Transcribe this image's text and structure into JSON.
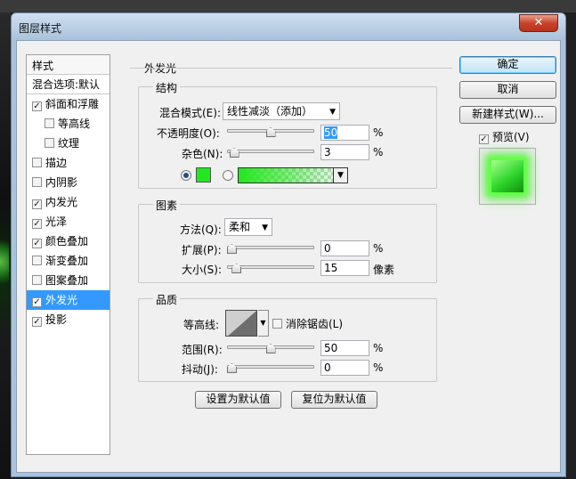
{
  "window": {
    "title": "图层样式",
    "close_label": "✕"
  },
  "style_list": {
    "header": "样式",
    "blend_options": "混合选项:默认",
    "items": [
      {
        "label": "斜面和浮雕",
        "checked": true,
        "sub": false,
        "selected": false
      },
      {
        "label": "等高线",
        "checked": false,
        "sub": true,
        "selected": false
      },
      {
        "label": "纹理",
        "checked": false,
        "sub": true,
        "selected": false
      },
      {
        "label": "描边",
        "checked": false,
        "sub": false,
        "selected": false
      },
      {
        "label": "内阴影",
        "checked": false,
        "sub": false,
        "selected": false
      },
      {
        "label": "内发光",
        "checked": true,
        "sub": false,
        "selected": false
      },
      {
        "label": "光泽",
        "checked": true,
        "sub": false,
        "selected": false
      },
      {
        "label": "颜色叠加",
        "checked": true,
        "sub": false,
        "selected": false
      },
      {
        "label": "渐变叠加",
        "checked": false,
        "sub": false,
        "selected": false
      },
      {
        "label": "图案叠加",
        "checked": false,
        "sub": false,
        "selected": false
      },
      {
        "label": "外发光",
        "checked": true,
        "sub": false,
        "selected": true
      },
      {
        "label": "投影",
        "checked": true,
        "sub": false,
        "selected": false
      }
    ]
  },
  "panel": {
    "title": "外发光",
    "structure": {
      "title": "结构",
      "blend_mode_label": "混合模式(E):",
      "blend_mode_value": "线性减淡（添加）",
      "opacity_label": "不透明度(O):",
      "opacity_value": "50",
      "opacity_fraction": 0.5,
      "noise_label": "杂色(N):",
      "noise_value": "3",
      "noise_fraction": 0.03,
      "percent": "%",
      "glow_color": "#22e81e"
    },
    "elements": {
      "title": "图素",
      "method_label": "方法(Q):",
      "method_value": "柔和",
      "spread_label": "扩展(P):",
      "spread_value": "0",
      "spread_fraction": 0,
      "size_label": "大小(S):",
      "size_value": "15",
      "size_fraction": 0.06,
      "percent": "%",
      "pixels": "像素"
    },
    "quality": {
      "title": "品质",
      "contour_label": "等高线:",
      "anti_alias_label": "消除锯齿(L)",
      "anti_alias_checked": false,
      "range_label": "范围(R):",
      "range_value": "50",
      "range_fraction": 0.5,
      "jitter_label": "抖动(J):",
      "jitter_value": "0",
      "jitter_fraction": 0,
      "percent": "%"
    },
    "set_default": "设置为默认值",
    "reset_default": "复位为默认值"
  },
  "actions": {
    "ok": "确定",
    "cancel": "取消",
    "new_style": "新建样式(W)...",
    "preview_label": "预览(V)",
    "preview_checked": true
  }
}
